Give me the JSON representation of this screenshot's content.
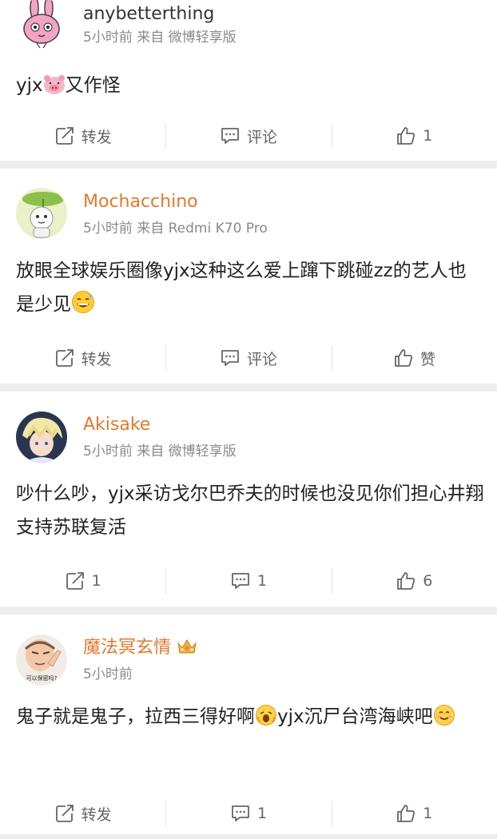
{
  "posts": [
    {
      "username": "anybetterthing",
      "meta": "5小时前 来自 微博轻享版",
      "text_before": "yjx",
      "emoji_1": "pig-face-emoji",
      "text_after": "又作怪",
      "actions": {
        "repost": "转发",
        "comment": "评论",
        "like": "1"
      },
      "avatar": "pink-rabbit-avatar"
    },
    {
      "username": "Mochacchino",
      "meta": "5小时前 来自 Redmi K70 Pro",
      "text_before": "放眼全球娱乐圈像yjx这种这么爱上蹿下跳碰zz的艺人也是少见",
      "emoji_1": "sweat-smile-emoji",
      "text_after": "",
      "actions": {
        "repost": "转发",
        "comment": "评论",
        "like": "赞"
      },
      "avatar": "sheep-leaf-avatar"
    },
    {
      "username": "Akisake",
      "meta": "5小时前 来自 微博轻享版",
      "text_before": "吵什么吵，yjx采访戈尔巴乔夫的时候也没见你们担心井翔支持苏联复活",
      "emoji_1": "",
      "text_after": "",
      "actions": {
        "repost": "1",
        "comment": "1",
        "like": "6"
      },
      "avatar": "blonde-character-avatar"
    },
    {
      "username": "魔法冥玄情",
      "meta": "5小时前",
      "text_before": "鬼子就是鬼子，拉西三得好啊",
      "emoji_1": "shocked-emoji",
      "text_after": "yjx沉尸台湾海峡吧",
      "emoji_2": "smile-emoji",
      "actions": {
        "repost": "转发",
        "comment": "1",
        "like": "1"
      },
      "avatar": "pointing-man-avatar",
      "avatar_caption": "可以保密吗?"
    }
  ],
  "colors": {
    "vip_name": "#e07a2e",
    "normal_name": "#333333",
    "meta": "#8a8a8a",
    "separator": "#ededed"
  },
  "icons": {
    "repost": "repost-icon",
    "comment": "comment-icon",
    "like": "thumbs-up-icon",
    "badge": "crown-badge-icon"
  }
}
